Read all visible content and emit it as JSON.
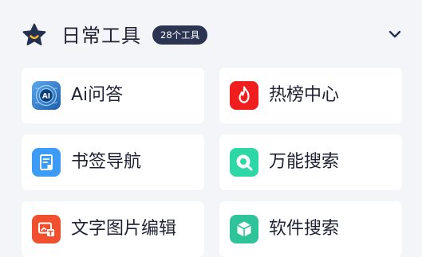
{
  "section": {
    "title": "日常工具",
    "badge": "28个工具",
    "star_icon": "star-icon",
    "toggle_icon": "chevron-down-icon"
  },
  "tools": [
    {
      "label": "Ai问答",
      "icon": "ai-chat-icon",
      "color": "#2e7bd1"
    },
    {
      "label": "热榜中心",
      "icon": "flame-icon",
      "color": "#f01e1e"
    },
    {
      "label": "书签导航",
      "icon": "bookmark-icon",
      "color": "#3b9bf6"
    },
    {
      "label": "万能搜索",
      "icon": "magnifier-icon",
      "color": "#2ed7a6"
    },
    {
      "label": "文字图片编辑",
      "icon": "image-edit-icon",
      "color": "#f0502e"
    },
    {
      "label": "软件搜索",
      "icon": "cube-icon",
      "color": "#2fc39a"
    }
  ],
  "colors": {
    "background": "#f4f5f8",
    "card": "#ffffff",
    "text": "#1f2235",
    "badge_bg": "#2b3551",
    "star": "#243052",
    "star_smile": "#f5b525"
  }
}
